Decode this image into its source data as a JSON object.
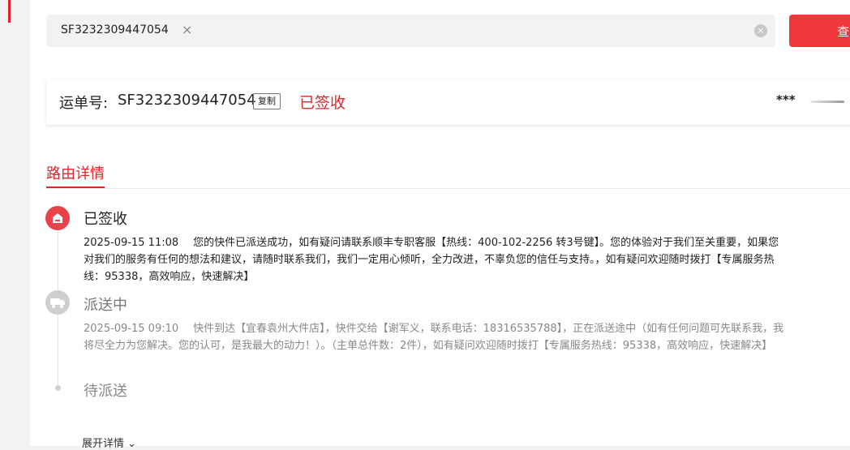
{
  "search": {
    "value": "SF3232309447054",
    "tag_remove": "×",
    "clear": "×",
    "button_label": "查"
  },
  "waybill": {
    "label": "运单号:",
    "number": "SF3232309447054",
    "copy_label": "复制",
    "status": "已签收",
    "masked_name": "***"
  },
  "tabs": [
    {
      "label": "路由详情"
    }
  ],
  "timeline": [
    {
      "title": "已签收",
      "time": "2025-09-15 11:08",
      "text": "您的快件已派送成功，如有疑问请联系顺丰专职客服【热线：400-102-2256 转3号键】。您的体验对于我们至关重要，如果您对我们的服务有任何的想法和建议，请随时联系我们，我们一定用心倾听，全力改进，不辜负您的信任与支持。，如有疑问欢迎随时拨打【专属服务热线：95338，高效响应，快速解决】",
      "icon": "signed-house-icon"
    },
    {
      "title": "派送中",
      "time": "2025-09-15 09:10",
      "text": "快件到达【宜春袁州大件店】，快件交给【谢军义，联系电话：18316535788】，正在派送途中（如有任何问题可先联系我，我将尽全力为您解决。您的认可，是我最大的动力！）。（主单总件数：2件），如有疑问欢迎随时拨打【专属服务热线：95338，高效响应，快速解决】",
      "icon": "delivery-truck-icon"
    },
    {
      "title": "待派送"
    }
  ],
  "expand_label": "展开详情",
  "colors": {
    "accent": "#e0252b",
    "button": "#f0373c",
    "muted": "#888888"
  }
}
